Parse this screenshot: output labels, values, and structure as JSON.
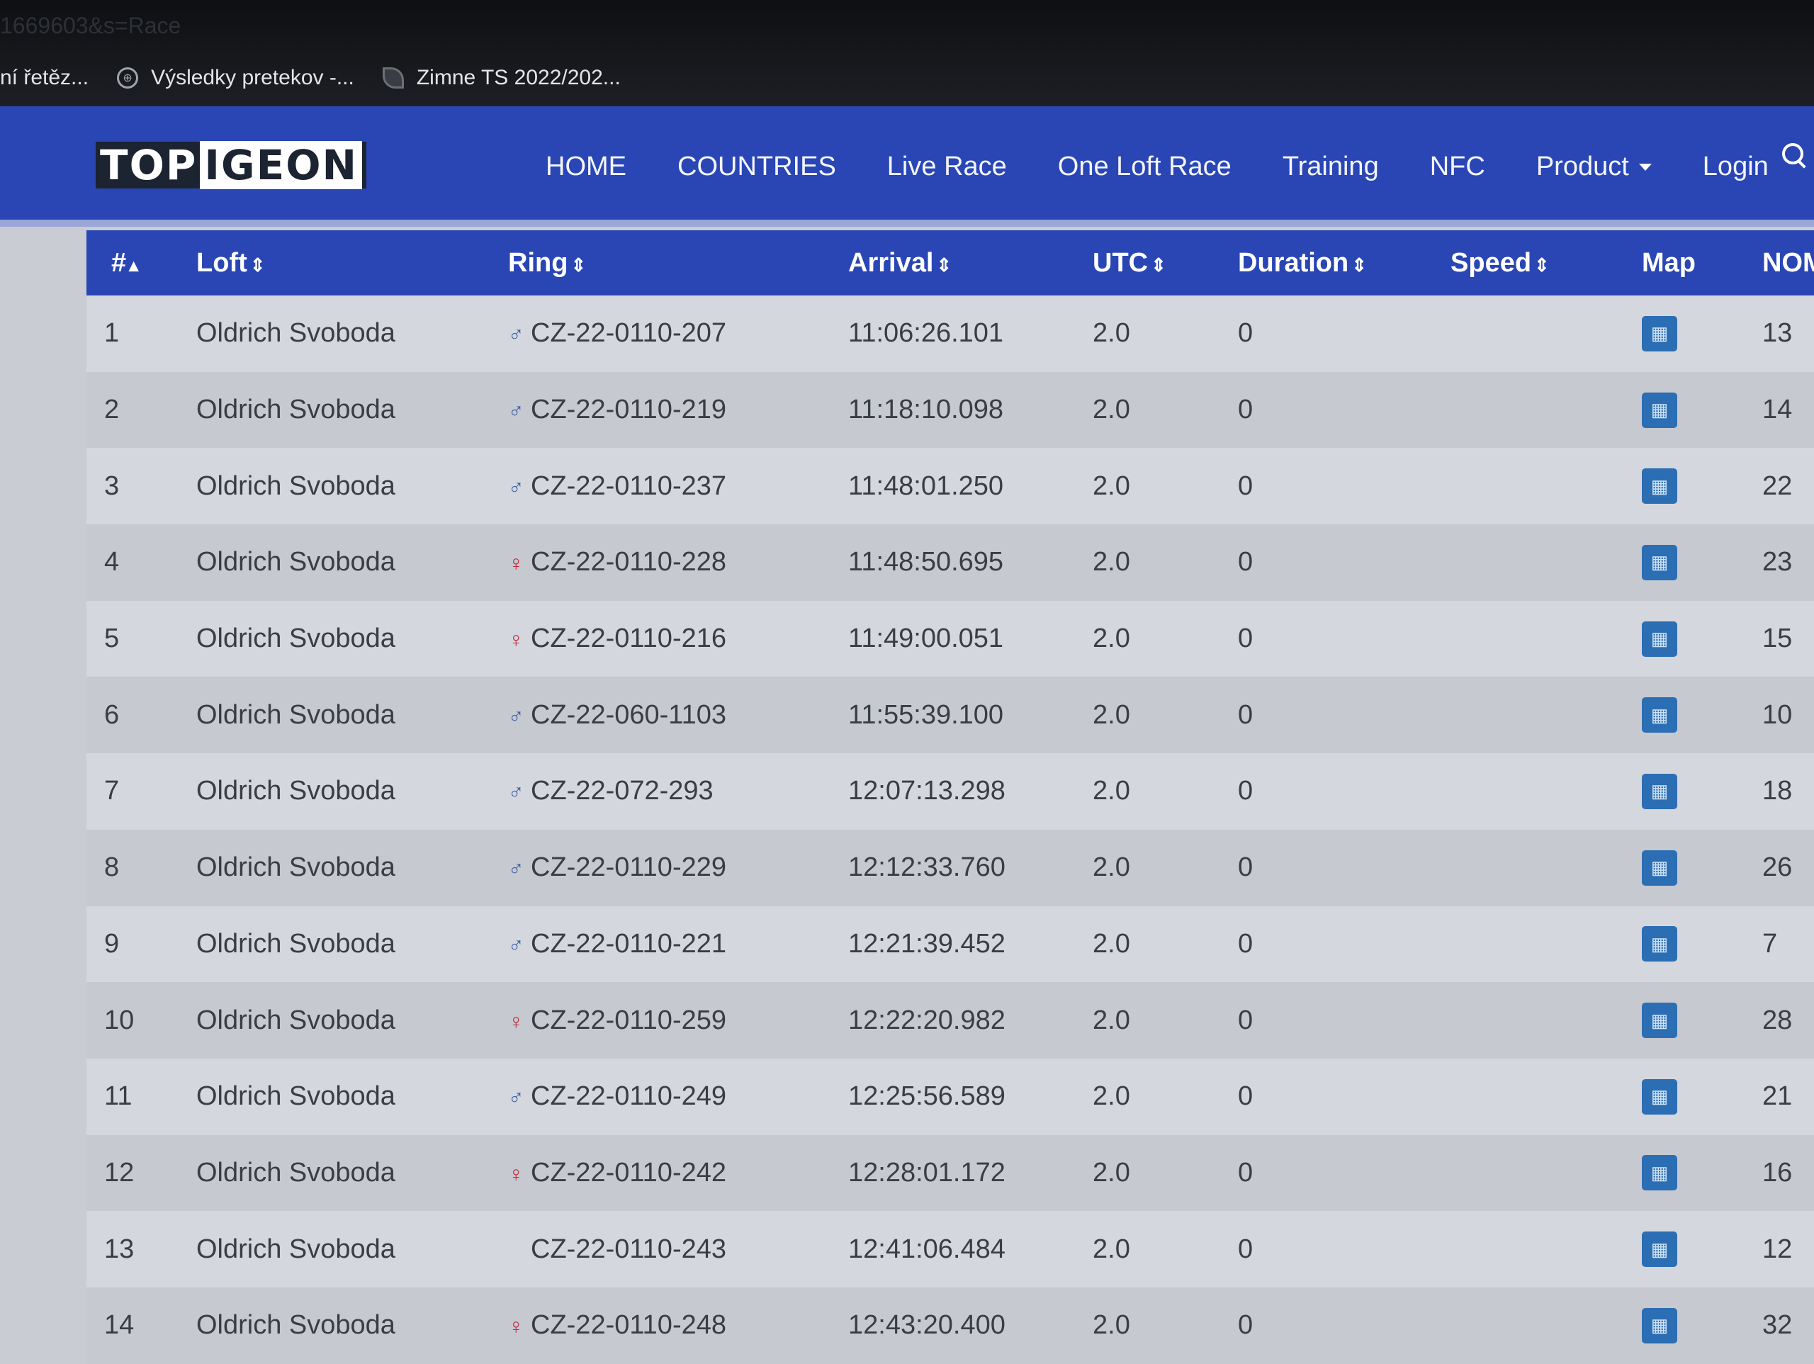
{
  "browser": {
    "url_fragment": "1669603&s=Race",
    "bookmarks": [
      {
        "icon": "globe-icon",
        "label": "ní řetěz..."
      },
      {
        "icon": "globe-icon",
        "label": "Výsledky pretekov -..."
      },
      {
        "icon": "leaf-icon",
        "label": "Zimne TS 2022/202..."
      }
    ]
  },
  "nav": {
    "logo_a": "TOP",
    "logo_b": "IGEON",
    "items": [
      "HOME",
      "COUNTRIES",
      "Live Race",
      "One Loft Race",
      "Training",
      "NFC",
      "Product",
      "Login"
    ]
  },
  "table": {
    "headers": [
      "#",
      "Loft",
      "Ring",
      "Arrival",
      "UTC",
      "Duration",
      "Speed",
      "Map",
      "NOM"
    ],
    "rows": [
      {
        "num": "1",
        "loft": "Oldrich Svoboda",
        "sex": "male",
        "sex_symbol": "♂",
        "ring": "CZ-22-0110-207",
        "arrival": "11:06:26.101",
        "utc": "2.0",
        "duration": "0",
        "speed": "",
        "nom": "13"
      },
      {
        "num": "2",
        "loft": "Oldrich Svoboda",
        "sex": "male",
        "sex_symbol": "♂",
        "ring": "CZ-22-0110-219",
        "arrival": "11:18:10.098",
        "utc": "2.0",
        "duration": "0",
        "speed": "",
        "nom": "14"
      },
      {
        "num": "3",
        "loft": "Oldrich Svoboda",
        "sex": "male",
        "sex_symbol": "♂",
        "ring": "CZ-22-0110-237",
        "arrival": "11:48:01.250",
        "utc": "2.0",
        "duration": "0",
        "speed": "",
        "nom": "22"
      },
      {
        "num": "4",
        "loft": "Oldrich Svoboda",
        "sex": "female",
        "sex_symbol": "♀",
        "ring": "CZ-22-0110-228",
        "arrival": "11:48:50.695",
        "utc": "2.0",
        "duration": "0",
        "speed": "",
        "nom": "23"
      },
      {
        "num": "5",
        "loft": "Oldrich Svoboda",
        "sex": "female",
        "sex_symbol": "♀",
        "ring": "CZ-22-0110-216",
        "arrival": "11:49:00.051",
        "utc": "2.0",
        "duration": "0",
        "speed": "",
        "nom": "15"
      },
      {
        "num": "6",
        "loft": "Oldrich Svoboda",
        "sex": "male",
        "sex_symbol": "♂",
        "ring": "CZ-22-060-1103",
        "arrival": "11:55:39.100",
        "utc": "2.0",
        "duration": "0",
        "speed": "",
        "nom": "10"
      },
      {
        "num": "7",
        "loft": "Oldrich Svoboda",
        "sex": "male",
        "sex_symbol": "♂",
        "ring": "CZ-22-072-293",
        "arrival": "12:07:13.298",
        "utc": "2.0",
        "duration": "0",
        "speed": "",
        "nom": "18"
      },
      {
        "num": "8",
        "loft": "Oldrich Svoboda",
        "sex": "male",
        "sex_symbol": "♂",
        "ring": "CZ-22-0110-229",
        "arrival": "12:12:33.760",
        "utc": "2.0",
        "duration": "0",
        "speed": "",
        "nom": "26"
      },
      {
        "num": "9",
        "loft": "Oldrich Svoboda",
        "sex": "male",
        "sex_symbol": "♂",
        "ring": "CZ-22-0110-221",
        "arrival": "12:21:39.452",
        "utc": "2.0",
        "duration": "0",
        "speed": "",
        "nom": "7"
      },
      {
        "num": "10",
        "loft": "Oldrich Svoboda",
        "sex": "female",
        "sex_symbol": "♀",
        "ring": "CZ-22-0110-259",
        "arrival": "12:22:20.982",
        "utc": "2.0",
        "duration": "0",
        "speed": "",
        "nom": "28"
      },
      {
        "num": "11",
        "loft": "Oldrich Svoboda",
        "sex": "male",
        "sex_symbol": "♂",
        "ring": "CZ-22-0110-249",
        "arrival": "12:25:56.589",
        "utc": "2.0",
        "duration": "0",
        "speed": "",
        "nom": "21"
      },
      {
        "num": "12",
        "loft": "Oldrich Svoboda",
        "sex": "female",
        "sex_symbol": "♀",
        "ring": "CZ-22-0110-242",
        "arrival": "12:28:01.172",
        "utc": "2.0",
        "duration": "0",
        "speed": "",
        "nom": "16"
      },
      {
        "num": "13",
        "loft": "Oldrich Svoboda",
        "sex": "none",
        "sex_symbol": "",
        "ring": "CZ-22-0110-243",
        "arrival": "12:41:06.484",
        "utc": "2.0",
        "duration": "0",
        "speed": "",
        "nom": "12"
      },
      {
        "num": "14",
        "loft": "Oldrich Svoboda",
        "sex": "female",
        "sex_symbol": "♀",
        "ring": "CZ-22-0110-248",
        "arrival": "12:43:20.400",
        "utc": "2.0",
        "duration": "0",
        "speed": "",
        "nom": "32"
      }
    ]
  },
  "colors": {
    "nav_bg": "#2a46b5",
    "map_button": "#2c6eb3",
    "male": "#3b5fa6",
    "female": "#c2283a"
  }
}
